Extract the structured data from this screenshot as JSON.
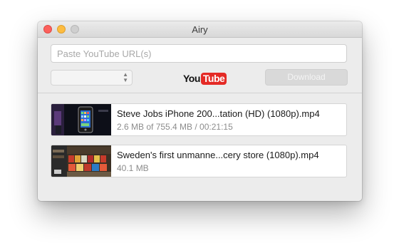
{
  "window": {
    "title": "Airy"
  },
  "toolbar": {
    "url_placeholder": "Paste YouTube URL(s)",
    "url_value": "",
    "format_selected": "",
    "logo_you": "You",
    "logo_tube": "Tube",
    "download_label": "Download"
  },
  "downloads": [
    {
      "title": "Steve Jobs iPhone 200...tation (HD) (1080p).mp4",
      "status": "2.6 MB of 755.4 MB / 00:21:15",
      "thumbnail": "iphone-keynote-thumbnail"
    },
    {
      "title": "Sweden's first unmanne...cery store (1080p).mp4",
      "status": "40.1 MB",
      "thumbnail": "grocery-store-thumbnail"
    }
  ],
  "colors": {
    "close": "#fc605c",
    "minimize": "#fdbc40",
    "maximize": "#cfcfcf",
    "youtube_red": "#e42a25",
    "window_bg": "#ececec"
  }
}
